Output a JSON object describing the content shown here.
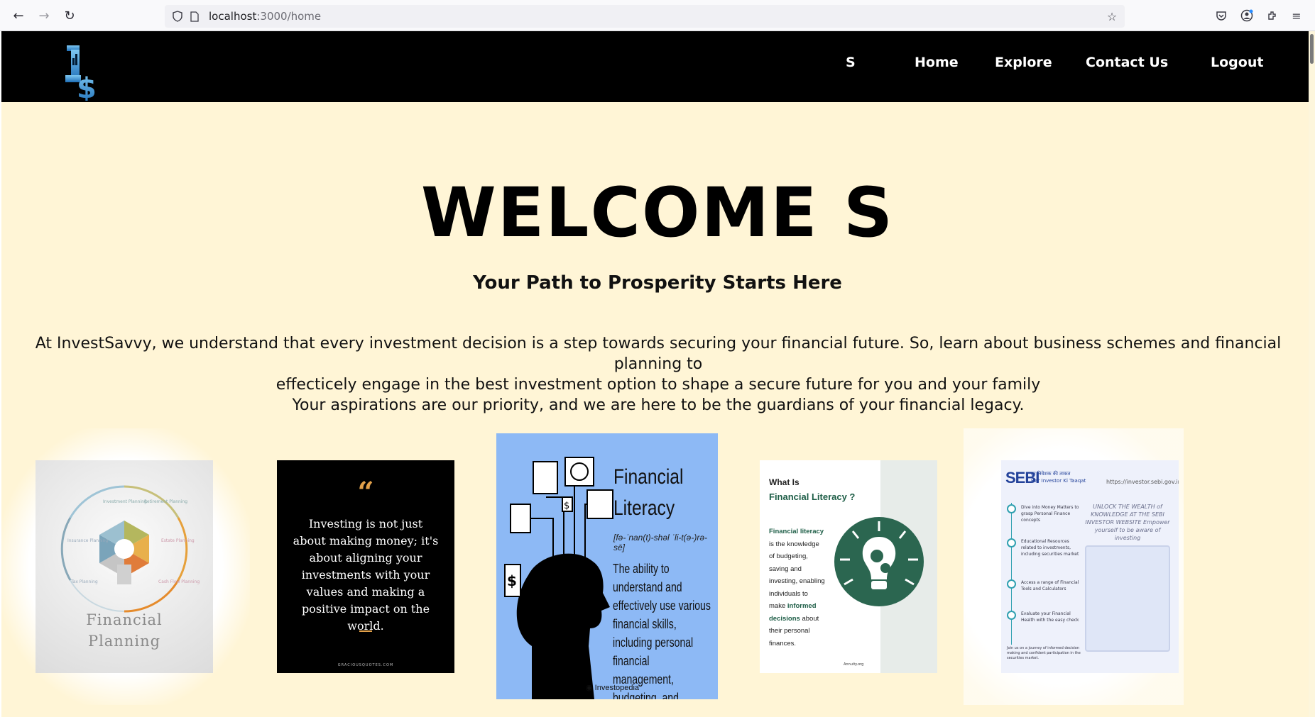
{
  "browser": {
    "url_host": "localhost",
    "url_path": ":3000/home"
  },
  "header": {
    "nav": {
      "user": "S",
      "home": "Home",
      "explore": "Explore",
      "contact": "Contact Us",
      "logout": "Logout"
    }
  },
  "hero": {
    "title": "WELCOME S",
    "tagline": "Your Path to Prosperity Starts Here",
    "intro_line1": "At InvestSavvy, we understand that every investment decision is a step towards securing your financial future. So, learn about business schemes and financial planning to",
    "intro_line2": "effecticely engage in the best investment option to shape a secure future for you and your family",
    "intro_line3": "Your aspirations are our priority, and we are here to be the guardians of your financial legacy."
  },
  "gallery": {
    "card1": {
      "title_line1": "Financial",
      "title_line2": "Planning",
      "segments": [
        "Investment Planning",
        "Retirement Planning",
        "Estate Planning",
        "Cash Flow Planning",
        "Tax Planning",
        "Insurance Planning"
      ]
    },
    "card2": {
      "quote": "Investing is not just about making money; it's about aligning your investments with your values and making a positive impact on the world.",
      "source": "GRACIOUSQUOTES.COM"
    },
    "card3": {
      "title_line1": "Financial",
      "title_line2": "Literacy",
      "pronunciation": "[fə-ˈnan(t)-shəl ˈli-t(ə-)rə-sē]",
      "definition": "The ability to understand and effectively use various financial skills, including personal financial management, budgeting, and investing.",
      "brand": "Investopedia"
    },
    "card4": {
      "question_line1": "What Is",
      "question_line2": "Financial Literacy ?",
      "body_b1": "Financial literacy",
      "body_1": " is the knowledge of budgeting, saving and investing, enabling individuals to make ",
      "body_b2": "informed decisions",
      "body_2": " about their personal finances.",
      "brand": "Annuity.org"
    },
    "card5": {
      "logo": "SEBI",
      "hindi_line1": "हर निवेशक की ताकत",
      "hindi_line2": "Har Investor Ki Taaqat",
      "url": "https://investor.sebi.gov.in",
      "headline": "UNLOCK THE WEALTH of KNOWLEDGE AT THE SEBI INVESTOR WEBSITE Empower yourself to be aware of investing",
      "steps": [
        "Dive into Money Matters to grasp Personal Finance concepts",
        "Educational Resources related to investments, including securities market",
        "Access a range of Financial Tools and Calculators",
        "Evaluate your Financial Health with the easy check"
      ],
      "footer": "Join us on a journey of informed decision making and confident participation in the securities market."
    }
  },
  "colors": {
    "header_bg": "#000000",
    "page_bg": "#fff5d6",
    "card3_bg": "#8db9f5",
    "card4_accent": "#2b6650"
  }
}
